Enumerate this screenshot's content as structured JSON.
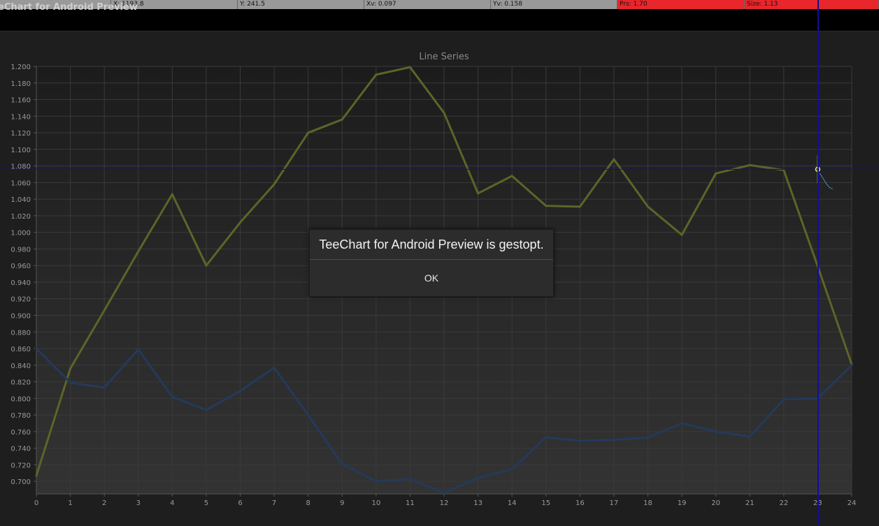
{
  "status_bar": {
    "cells": [
      {
        "text": "",
        "bg": "#999999"
      },
      {
        "text": "X: 1193.8",
        "bg": "#999999"
      },
      {
        "text": "Y: 241.5",
        "bg": "#999999"
      },
      {
        "text": "Xv: 0.097",
        "bg": "#999999"
      },
      {
        "text": "Yv: 0.158",
        "bg": "#999999"
      },
      {
        "text": "Prs: 1.70",
        "bg": "#e8262b"
      },
      {
        "text": "Size: 1.13",
        "bg": "#e8262b"
      }
    ]
  },
  "app": {
    "title": "eChart for Android Preview"
  },
  "chart_data": {
    "type": "line",
    "title": "Line Series",
    "xlabel": "",
    "ylabel": "",
    "x": [
      0,
      1,
      2,
      3,
      4,
      5,
      6,
      7,
      8,
      9,
      10,
      11,
      12,
      13,
      14,
      15,
      16,
      17,
      18,
      19,
      20,
      21,
      22,
      23,
      24
    ],
    "xlim": [
      0,
      24
    ],
    "ylim": [
      685,
      1200
    ],
    "yticks": [
      700,
      720,
      740,
      760,
      780,
      800,
      820,
      840,
      860,
      880,
      900,
      920,
      940,
      960,
      980,
      1000,
      1020,
      1040,
      1060,
      1080,
      1100,
      1120,
      1140,
      1160,
      1180,
      1200
    ],
    "grid": true,
    "series": [
      {
        "color": "#5d6428",
        "values": [
          707,
          836,
          906,
          977,
          1046,
          960,
          1012,
          1058,
          1120,
          1136,
          1190,
          1199,
          1144,
          1047,
          1068,
          1032,
          1031,
          1088,
          1031,
          997,
          1071,
          1081,
          1075,
          959,
          841
        ]
      },
      {
        "color": "#233a5c",
        "values": [
          860,
          819,
          813,
          859,
          802,
          786,
          809,
          837,
          780,
          721,
          700,
          703,
          686,
          704,
          715,
          753,
          749,
          750,
          753,
          770,
          760,
          754,
          799,
          800,
          840
        ]
      }
    ],
    "crosshair": {
      "x": 23,
      "y": 1076,
      "color": "#10109a"
    }
  },
  "dialog": {
    "message": "TeeChart for Android Preview is gestopt.",
    "ok_label": "OK"
  }
}
